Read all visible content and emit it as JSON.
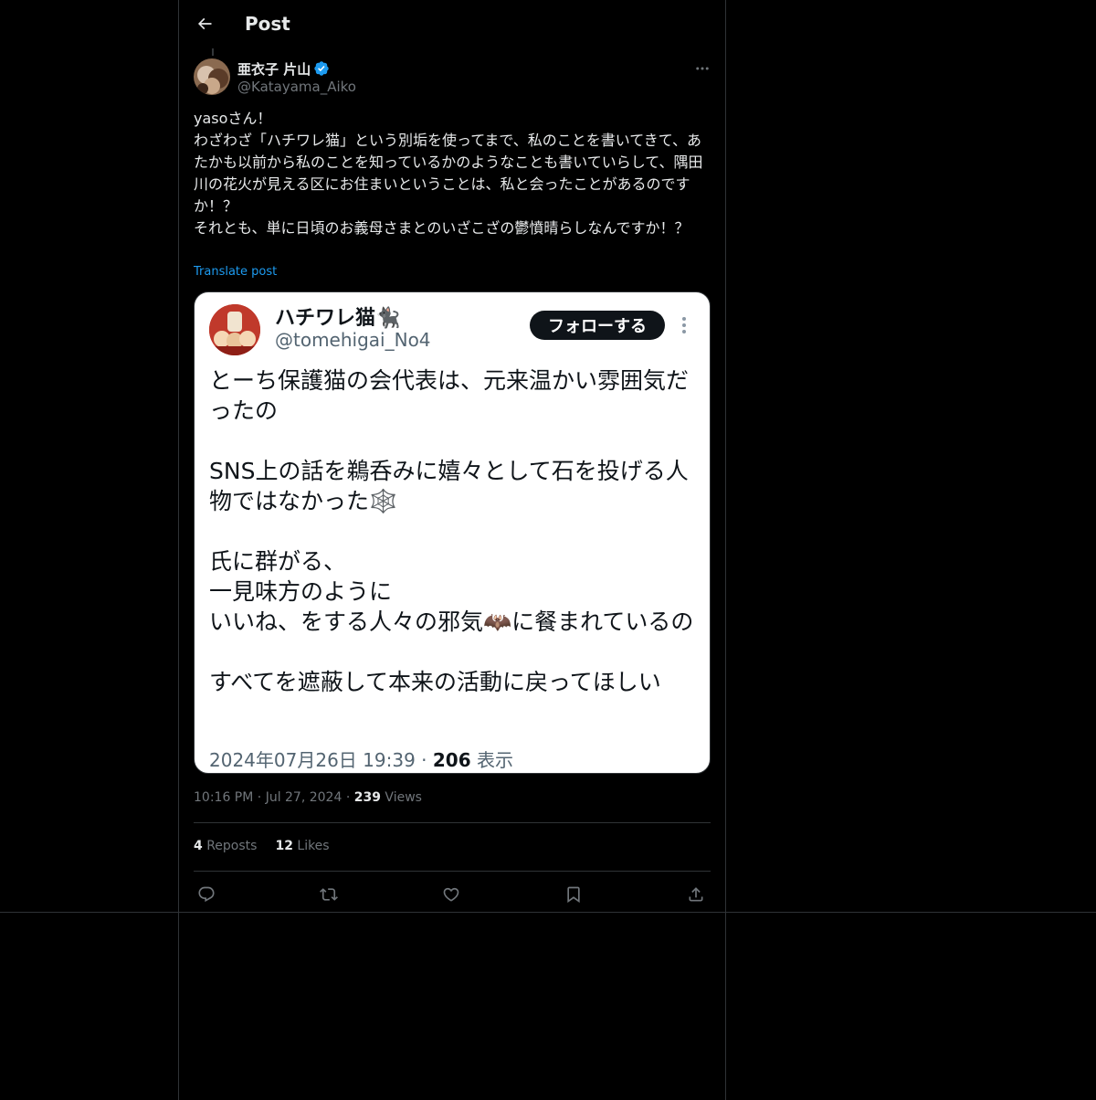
{
  "header": {
    "title": "Post"
  },
  "author": {
    "name": "亜衣子 片山",
    "handle": "@Katayama_Aiko",
    "verified": true
  },
  "post": {
    "text": "yasoさん！\nわざわざ「ハチワレ猫」という別垢を使ってまで、私のことを書いてきて、あたかも以前から私のことを知っているかのようなことも書いていらして、隅田川の花火が見える区にお住まいということは、私と会ったことがあるのですか！？\nそれとも、単に日頃のお義母さまとのいざこざの鬱憤晴らしなんですか！？",
    "translate_label": "Translate post"
  },
  "embedded": {
    "name": "ハチワレ猫🐈‍⬛",
    "handle": "@tomehigai_No4",
    "follow_label": "フォローする",
    "text": "とーち保護猫の会代表は、元来温かい雰囲気だったの\n\nSNS上の話を鵜呑みに嬉々として石を投げる人物ではなかった🕸️\n\n氏に群がる、\n一見味方のように\nいいね、をする人々の邪気🦇に餐まれているの\n\nすべてを遮蔽して本来の活動に戻ってほしい",
    "date": "2024年07月26日 19:39 · ",
    "views_count": "206",
    "views_label": " 表示"
  },
  "meta": {
    "time": "10:16 PM",
    "sep1": " · ",
    "date": "Jul 27, 2024",
    "sep2": " · ",
    "views_count": "239",
    "views_label": " Views"
  },
  "stats": {
    "reposts_count": "4",
    "reposts_label": " Reposts",
    "likes_count": "12",
    "likes_label": " Likes"
  },
  "colors": {
    "background": "#000000",
    "text": "#e7e9ea",
    "secondary": "#71767b",
    "accent": "#1d9bf0",
    "border": "#2f3336"
  },
  "icons": [
    "back-arrow-icon",
    "verified-badge-icon",
    "more-icon",
    "reply-icon",
    "repost-icon",
    "like-icon",
    "bookmark-icon",
    "share-icon"
  ]
}
